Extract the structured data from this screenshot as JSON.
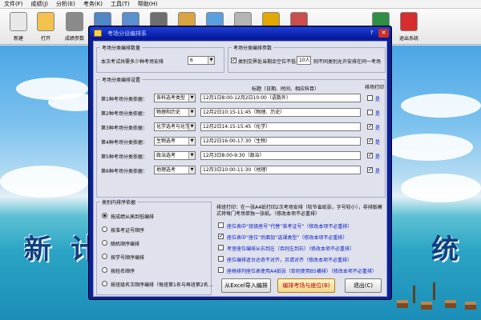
{
  "menu": [
    "文件(F)",
    "成绩(J)",
    "分析(E)",
    "考务(K)",
    "工具(T)",
    "帮助(H)"
  ],
  "toolbar": [
    {
      "label": "新建",
      "icon": "new-document-icon",
      "color": "#e8e8e8"
    },
    {
      "label": "打开",
      "icon": "open-folder-icon",
      "color": "#f2c14e"
    },
    {
      "label": "成绩参数",
      "icon": "tools-icon",
      "color": "#8a8a8a"
    },
    {
      "label": "",
      "icon": "calendar-icon",
      "color": "#4f86c6"
    },
    {
      "label": "",
      "icon": "search-icon",
      "color": "#5a8fd0"
    },
    {
      "label": "",
      "icon": "wrench-icon",
      "color": "#6f6f6f"
    },
    {
      "label": "",
      "icon": "notes-icon",
      "color": "#d9a441"
    },
    {
      "label": "",
      "icon": "book-icon",
      "color": "#5aa0e0"
    },
    {
      "label": "",
      "icon": "clock-icon",
      "color": "#b4b4b4"
    },
    {
      "label": "",
      "icon": "trophy-icon",
      "color": "#e0a800"
    },
    {
      "label": "",
      "icon": "award-icon",
      "color": "#c94f4f"
    },
    {
      "label": "一键导出",
      "icon": "excel-icon",
      "color": "#2f8f46"
    },
    {
      "label": "退出系统",
      "icon": "power-icon",
      "color": "#d62d2d"
    }
  ],
  "background_title_left": "新 计",
  "background_title_right": "统",
  "dialog": {
    "title": "考场分设编排系",
    "help_label": "?",
    "close_label": "✕",
    "seat_group": {
      "legend": "考场分类编排数量",
      "question": "本次考试共需多少种考场安排",
      "count_value": "6"
    },
    "param_group": {
      "legend": "考场分类编排参数",
      "checkbox_label_pre": "类别交界处当剩余空位不低于",
      "threshold": "10人",
      "checkbox_label_post": "则不同类别允许安排在同一考场",
      "checked": true
    },
    "class_group": {
      "legend": "考场分类编排设置",
      "header_time": "标题（日期、时间、相应科目）",
      "header_print": "排场打印",
      "rows": [
        {
          "label": "第1种考场分类依据：",
          "type": "各科选考类型",
          "time": "12月1日8:00-12月2日10:00（语数外）",
          "print_label": "是",
          "checked": false
        },
        {
          "label": "第2种考场分类依据：",
          "type": "物理和历史",
          "time": "12月2日10:15-11:45（物理、历史）",
          "print_label": "是",
          "checked": false
        },
        {
          "label": "第3种考场分类依据：",
          "type": "化学选考与化学",
          "time": "12月2日14:15-15:45（化学）",
          "print_label": "是",
          "checked": true
        },
        {
          "label": "第4种考场分类依据：",
          "type": "生物选考",
          "time": "12月2日16:00-17:30（生物）",
          "print_label": "是",
          "checked": true
        },
        {
          "label": "第5种考场分类依据：",
          "type": "政治选考",
          "time": "12月3日8:00-9:30（政治）",
          "print_label": "是",
          "checked": true
        },
        {
          "label": "第6种考场分类依据：",
          "type": "地理选考",
          "time": "12月3日10:00-11:30（地理）",
          "print_label": "是",
          "checked": true
        }
      ]
    },
    "sort_group": {
      "legend": "类别内排序依据",
      "options": [
        {
          "label": "按成绩从高到低编排",
          "selected": true
        },
        {
          "label": "按准考证号顺序",
          "selected": false
        },
        {
          "label": "随机顺序编排",
          "selected": false
        },
        {
          "label": "按学号顺序编排",
          "selected": false
        },
        {
          "label": "按姓名顺序",
          "selected": false
        },
        {
          "label": "按班级名次顺序编排（每班第1名与再班第2名...",
          "selected": false
        }
      ]
    },
    "print_note": "排班打印：在一张A4纸打印2次考场安排（较节省纸张，字号较小），非排版模式将每门考场单独一张纸。（修改本项不必重排）",
    "options": [
      {
        "label": "座位表中“班级座号”代替“准考证号”（修改本项不必重排）",
        "checked": false
      },
      {
        "label": "座位表中“座位”后面加“选课类型”（修改本项不必重排）",
        "checked": true
      },
      {
        "label": "考室座位编排从右到左（否则左到右）（修改本项不必重排）",
        "checked": false
      },
      {
        "label": "座位编排逐台达奇不对齐，另请对齐（修改本项不必重排）",
        "checked": false
      },
      {
        "label": "座椅排列座位表使用A4纸张（否则使用B5横排）（修改本项不必重排）",
        "checked": false
      }
    ],
    "buttons": {
      "import": "从Excel导入编排",
      "arrange": "编排考场与座位(B)",
      "exit": "退出(C)"
    }
  }
}
